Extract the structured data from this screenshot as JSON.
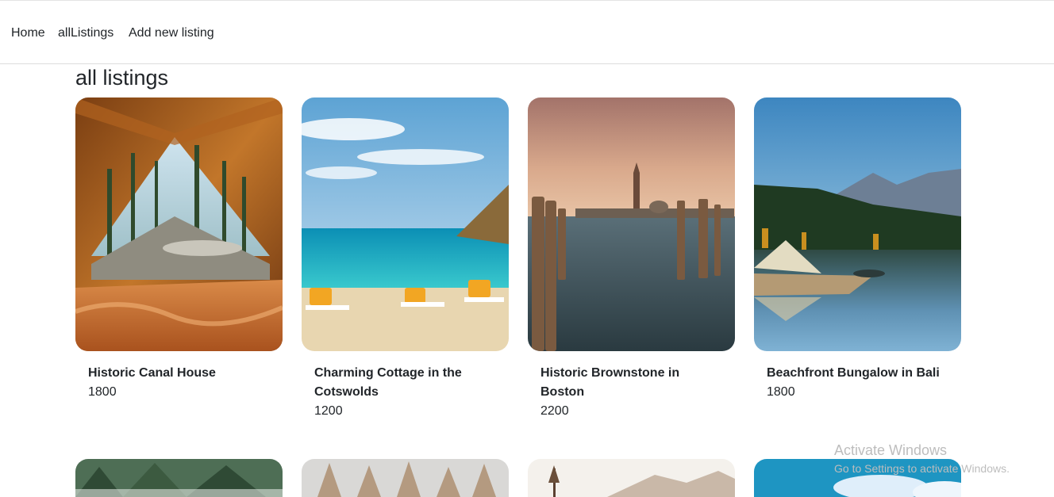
{
  "nav": {
    "home": "Home",
    "all_listings": "allListings",
    "add_new": "Add new listing"
  },
  "page": {
    "title": "all listings"
  },
  "listings": [
    {
      "title": "Historic Canal House",
      "price": "1800",
      "image": "tent-forest-view"
    },
    {
      "title": "Charming Cottage in the Cotswolds",
      "price": "1200",
      "image": "tropical-beach"
    },
    {
      "title": "Historic Brownstone in Boston",
      "price": "2200",
      "image": "venice-lagoon"
    },
    {
      "title": "Beachfront Bungalow in Bali",
      "price": "1800",
      "image": "lake-tent-mountains"
    }
  ],
  "next_row_images": [
    "pine-forest",
    "snowy-forest",
    "misty-mountains",
    "blue-sky-clouds"
  ],
  "watermark": {
    "title": "Activate Windows",
    "subtitle": "Go to Settings to activate Windows."
  }
}
